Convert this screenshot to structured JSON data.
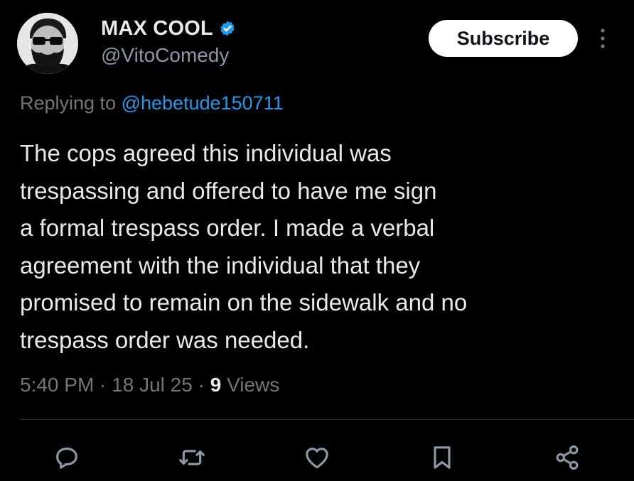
{
  "author": {
    "display_name": "MAX COOL",
    "handle": "@VitoComedy",
    "verified": true
  },
  "subscribe_label": "Subscribe",
  "reply": {
    "prefix": "Replying to ",
    "handle": "@hebetude150711"
  },
  "tweet": {
    "lines": [
      "The cops agreed this individual was",
      "trespassing and offered to have me sign",
      "a formal trespass order. I made a verbal",
      "agreement with the individual that they",
      "promised to remain on the sidewalk and no",
      "trespass order was needed."
    ]
  },
  "meta": {
    "time": "5:40 PM",
    "date": "18 Jul 25",
    "views_count": "9",
    "views_label": "Views",
    "separator": "·"
  },
  "actions": [
    "reply-icon",
    "retweet-icon",
    "like-icon",
    "bookmark-icon",
    "share-icon"
  ],
  "colors": {
    "background": "#000000",
    "text": "#e7e9ea",
    "muted": "#71767b",
    "link": "#1d9bf0",
    "verified": "#1d9bf0"
  }
}
